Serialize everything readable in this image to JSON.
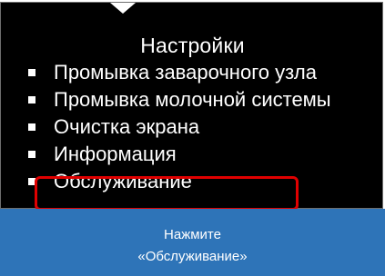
{
  "screen": {
    "title": "Настройки",
    "menu_items": [
      {
        "label": "Промывка заварочного узла"
      },
      {
        "label": "Промывка молочной системы"
      },
      {
        "label": "Очистка экрана"
      },
      {
        "label": "Информация"
      },
      {
        "label": "Обслуживание"
      }
    ],
    "highlighted_item": "Обслуживание",
    "highlight_color": "#e00000"
  },
  "hint": {
    "line1": "Нажмите",
    "line2": "«Обслуживание»",
    "background": "#2e74b8"
  },
  "icons": {
    "bullet": "square-bullet-icon"
  }
}
